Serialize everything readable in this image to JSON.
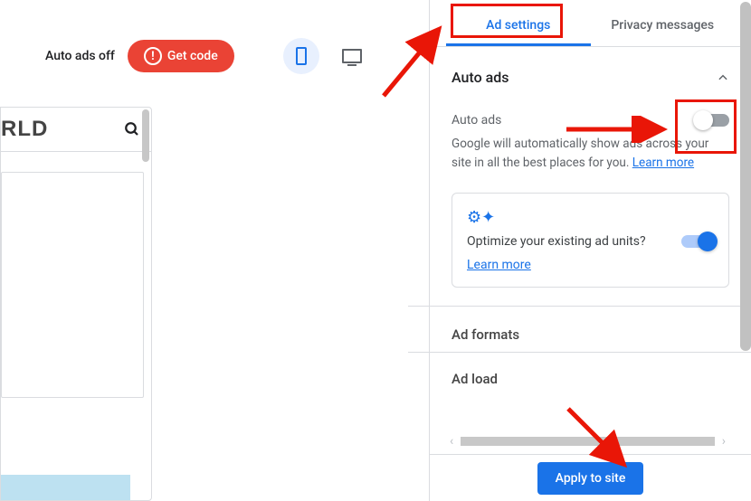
{
  "left": {
    "auto_ads_status": "Auto ads off",
    "get_code_label": "Get code",
    "preview_title": "RLD"
  },
  "panel": {
    "tabs": {
      "ad_settings": "Ad settings",
      "privacy_messages": "Privacy messages"
    },
    "auto_ads_section": "Auto ads",
    "auto_ads_row": "Auto ads",
    "help_text": "Google will automatically show ads across your site in all the best places for you. ",
    "learn_more": "Learn more",
    "optimize": {
      "text": "Optimize your existing ad units?",
      "learn_more": "Learn more"
    },
    "ad_formats": "Ad formats",
    "ad_load": "Ad load",
    "apply": "Apply to site"
  },
  "colors": {
    "primary": "#1a73e8",
    "danger": "#ea4335",
    "annotation": "#e91607"
  }
}
